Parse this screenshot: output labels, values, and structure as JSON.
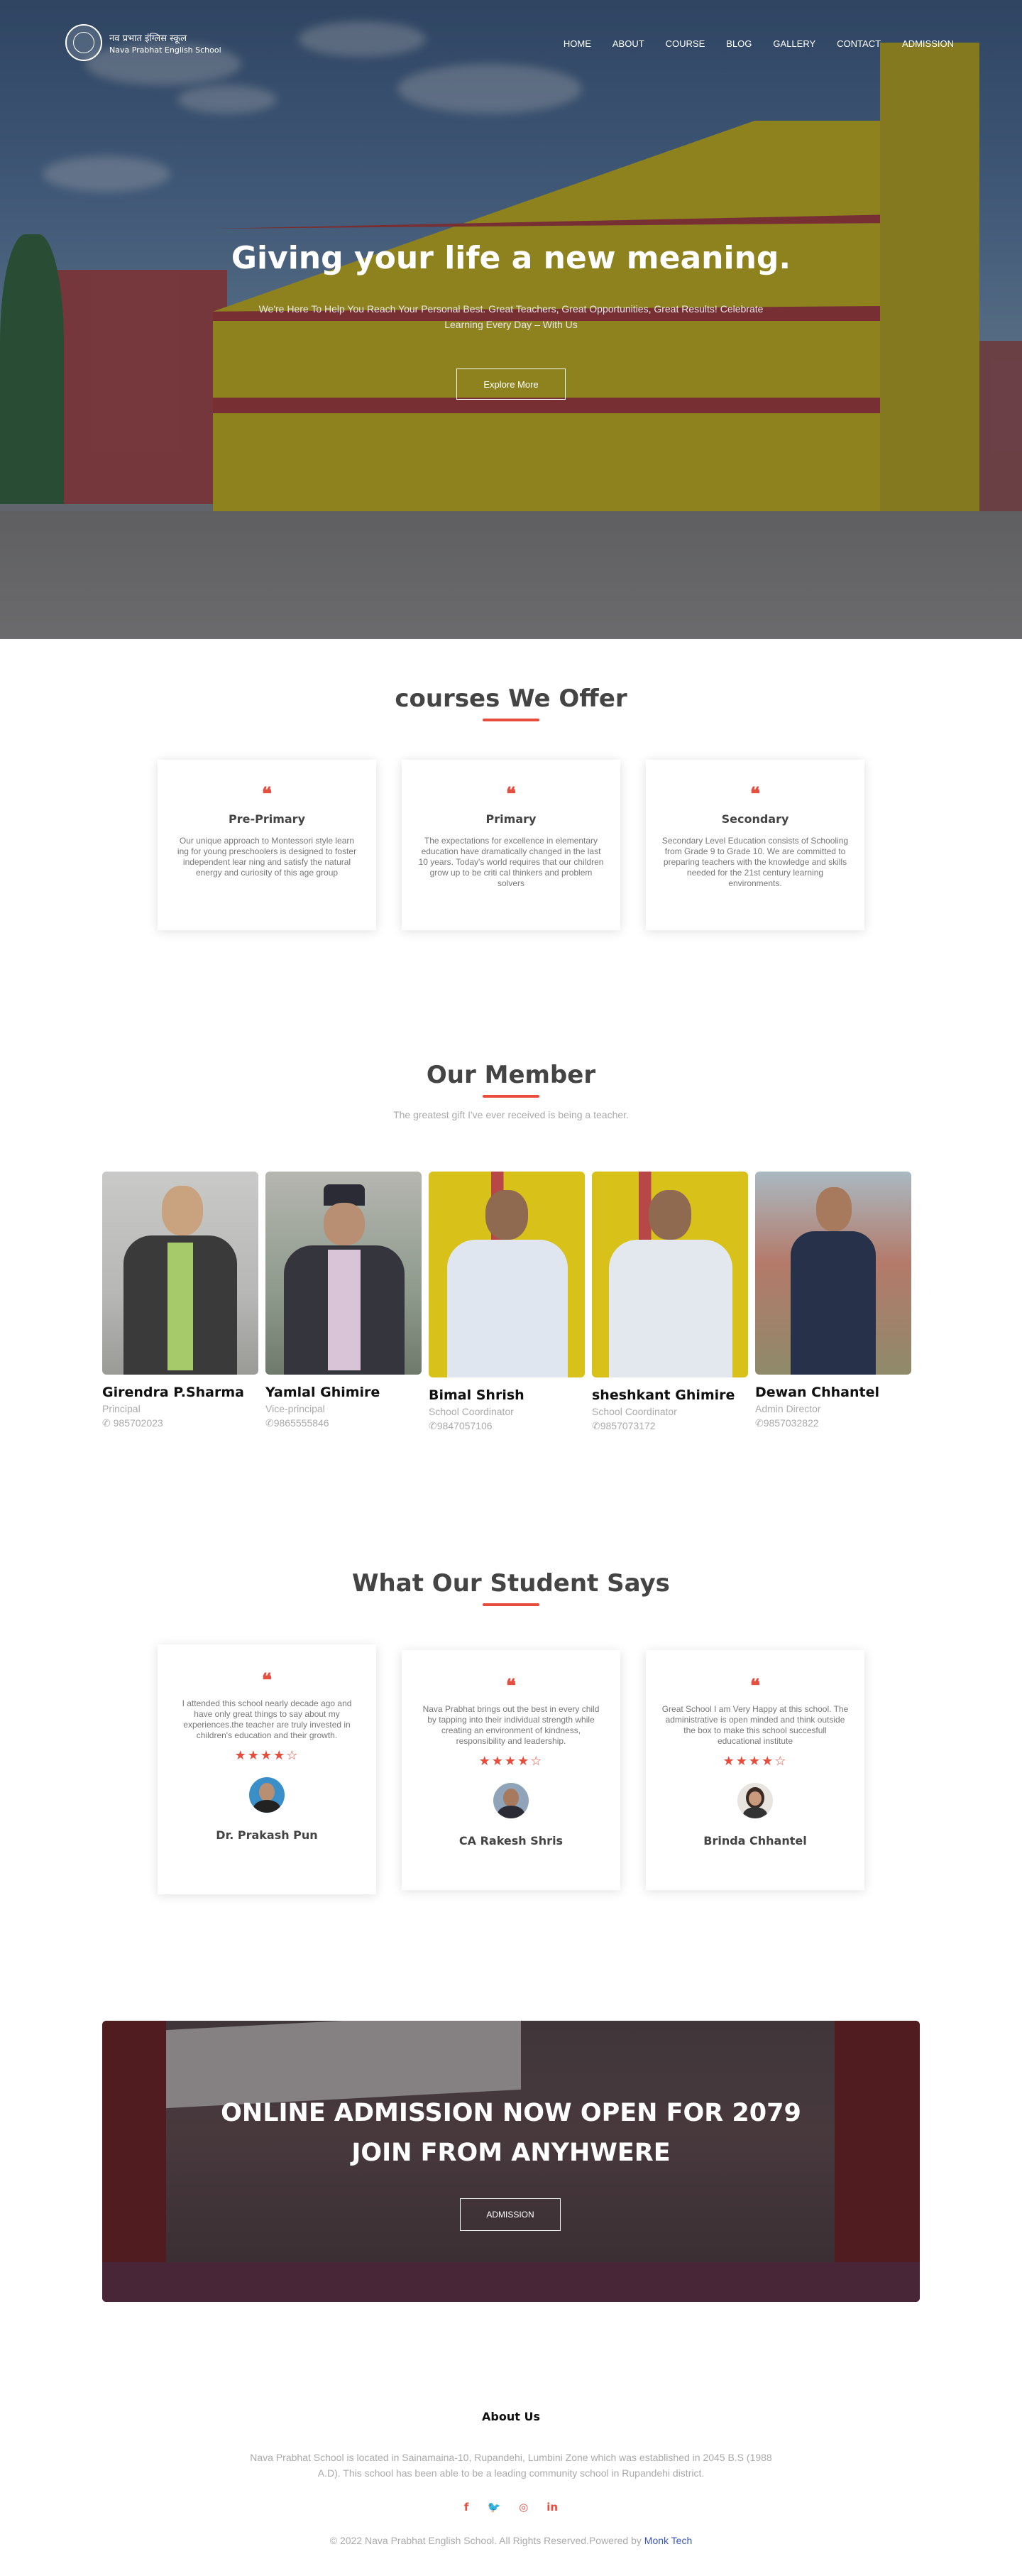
{
  "header": {
    "logo_line1": "नव प्रभात इंग्लिस स्कूल",
    "logo_line2": "Nava Prabhat English School",
    "nav": [
      "HOME",
      "ABOUT",
      "COURSE",
      "BLOG",
      "GALLERY",
      "CONTACT",
      "ADMISSION"
    ]
  },
  "hero": {
    "title": "Giving your life a new meaning.",
    "subtitle": "We're Here To Help You Reach Your Personal Best. Great Teachers, Great Opportunities, Great Results! Celebrate Learning Every Day – With Us",
    "button": "Explore More"
  },
  "courses": {
    "title": "courses We Offer",
    "items": [
      {
        "name": "Pre-Primary",
        "text": "Our unique approach to Montessori style learn ing for young preschoolers is designed to foster independent lear ning and satisfy the natural energy and curiosity of this age group"
      },
      {
        "name": "Primary",
        "text": "The expectations for excellence in elementary education have dramatically changed in the last 10 years. Today's world requires that our children grow up to be criti cal thinkers and problem solvers"
      },
      {
        "name": "Secondary",
        "text": "Secondary Level Education consists of Schooling from Grade 9 to Grade 10. We are committed to preparing teachers with the knowledge and skills needed for the 21st century learning environments."
      }
    ]
  },
  "members": {
    "title": "Our Member",
    "subtitle": "The greatest gift I've ever received is being a teacher.",
    "items": [
      {
        "name": "Girendra P.Sharma",
        "role": "Principal",
        "phone": "985702023"
      },
      {
        "name": "Yamlal Ghimire",
        "role": "Vice-principal",
        "phone": "9865555846"
      },
      {
        "name": "Bimal Shrish",
        "role": "School Coordinator",
        "phone": "9847057106"
      },
      {
        "name": "sheshkant Ghimire",
        "role": "School Coordinator",
        "phone": "9857073172"
      },
      {
        "name": "Dewan Chhantel",
        "role": "Admin Director",
        "phone": "9857032822"
      }
    ]
  },
  "testimonials": {
    "title": "What Our Student Says",
    "items": [
      {
        "text": "I attended this school nearly decade ago and have only great things to say about my experiences.the teacher are truly invested in children's education and their growth.",
        "stars": "★★★★☆",
        "name": "Dr. Prakash Pun"
      },
      {
        "text": "Nava Prabhat brings out the best in every child by tapping into their individual strength while creating an environment of kindness, responsibility and leadership.",
        "stars": "★★★★☆",
        "name": "CA Rakesh Shris"
      },
      {
        "text": "Great School I am Very Happy at this school. The administrative is open minded and think outside the box to make this school succesfull educational institute",
        "stars": "★★★★☆",
        "name": "Brinda Chhantel"
      }
    ]
  },
  "banner": {
    "line1": "ONLINE ADMISSION NOW OPEN FOR 2079",
    "line2": "JOIN FROM ANYHWERE",
    "button": "ADMISSION"
  },
  "footer": {
    "title": "About Us",
    "text": "Nava Prabhat School is located in Sainamaina-10, Rupandehi, Lumbini Zone which was established in 2045 B.S (1988 A.D). This school has been able to be a leading community school in Rupandehi district.",
    "socials": [
      "f",
      "🐦",
      "◎",
      "in"
    ],
    "copyright": "© 2022 Nava Prabhat English School. All Rights Reserved.Powered by ",
    "powered_by": "Monk Tech"
  },
  "colors": {
    "accent": "#e74c3c",
    "link": "#3b57b8"
  }
}
